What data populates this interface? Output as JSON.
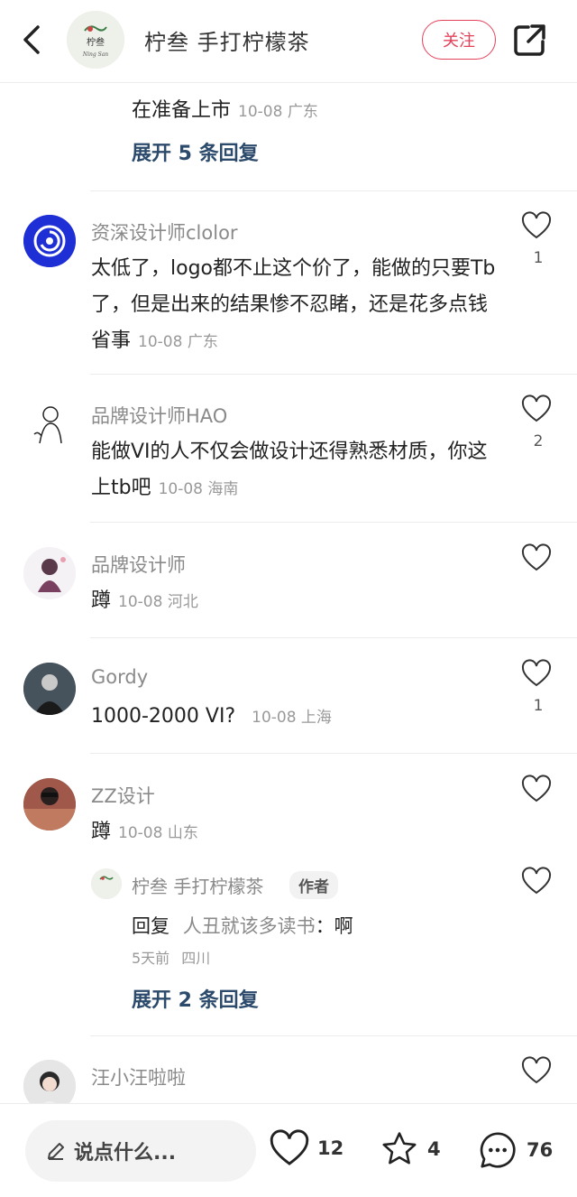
{
  "header": {
    "shop_name": "柠叁 手打柠檬茶",
    "follow_label": "关注",
    "avatar_text": "柠叁",
    "avatar_subtext": "Ning San"
  },
  "partial_top": {
    "text": "在准备上市",
    "meta": "10-08 广东",
    "expand_label": "展开 5 条回复"
  },
  "comments": [
    {
      "user": "资深设计师clolor",
      "text": "太低了，logo都不止这个价了，能做的只要Tb了，但是出来的结果惨不忍睹，还是花多点钱省事",
      "meta": "10-08 广东",
      "likes": "1"
    },
    {
      "user": "品牌设计师HAO",
      "text": "能做VI的人不仅会做设计还得熟悉材质，你这上tb吧",
      "meta": "10-08 海南",
      "likes": "2"
    },
    {
      "user": "品牌设计师",
      "text": "蹲",
      "meta": "10-08 河北",
      "likes": ""
    },
    {
      "user": "Gordy",
      "text": "1000-2000 VI?",
      "meta": "10-08 上海",
      "likes": "1"
    },
    {
      "user": "ZZ设计",
      "text": "蹲",
      "meta": "10-08 山东",
      "likes": ""
    },
    {
      "user": "汪小汪啦啦",
      "text": "",
      "meta": "",
      "likes": ""
    }
  ],
  "reply": {
    "user": "柠叁 手打柠檬茶",
    "badge": "作者",
    "prefix": "回复",
    "target": "人丑就该多读书",
    "text": "：啊",
    "time": "5天前",
    "location": "四川",
    "expand_label": "展开 2 条回复"
  },
  "bottom": {
    "placeholder": "说点什么...",
    "likes": "12",
    "stars": "4",
    "comments": "76"
  },
  "colors": {
    "accent": "#e3405a",
    "link": "#2c4a6b",
    "muted": "#999999"
  }
}
